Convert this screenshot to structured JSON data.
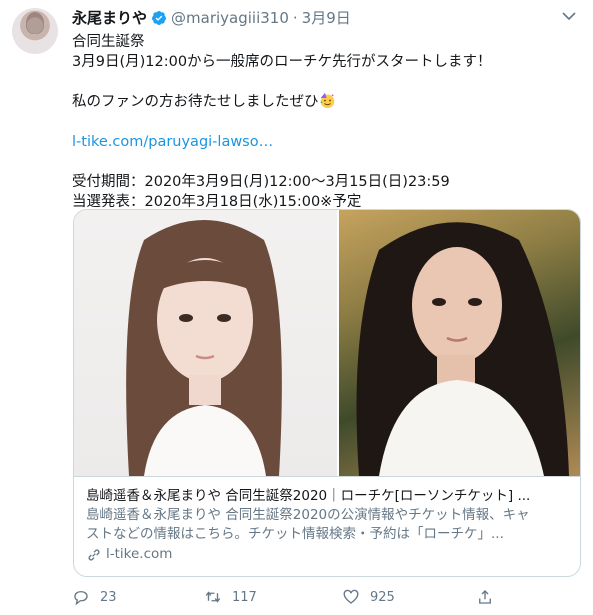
{
  "tweet": {
    "author_name": "永尾まりや",
    "handle": "@mariyagiii310",
    "separator": "·",
    "date": "3月9日",
    "lines": [
      "合同生誕祭",
      "3月9日(月)12:00から一般席のローチケ先行がスタートします！",
      "",
      "私のファンの方お待たせしましたぜひ",
      "",
      "l-tike.com/paruyagi-lawso…",
      "",
      "受付期間：2020年3月9日(月)12:00〜3月15日(日)23:59",
      "当選発表：2020年3月18日(水)15:00※予定"
    ]
  },
  "card": {
    "title": "島崎遥香＆永尾まりや 合同生誕祭2020｜ローチケ[ローソンチケット] ...",
    "description_lines": [
      "島崎遥香＆永尾まりや 合同生誕祭2020の公演情報やチケット情報、キャ",
      "ストなどの情報はこちら。チケット情報検索・予約は「ローチケ」..."
    ],
    "domain": "l-tike.com"
  },
  "actions": {
    "reply_count": "23",
    "retweet_count": "117",
    "like_count": "925"
  },
  "colors": {
    "link": "#1b95e0",
    "muted": "#657786",
    "verified": "#1da1f2"
  }
}
